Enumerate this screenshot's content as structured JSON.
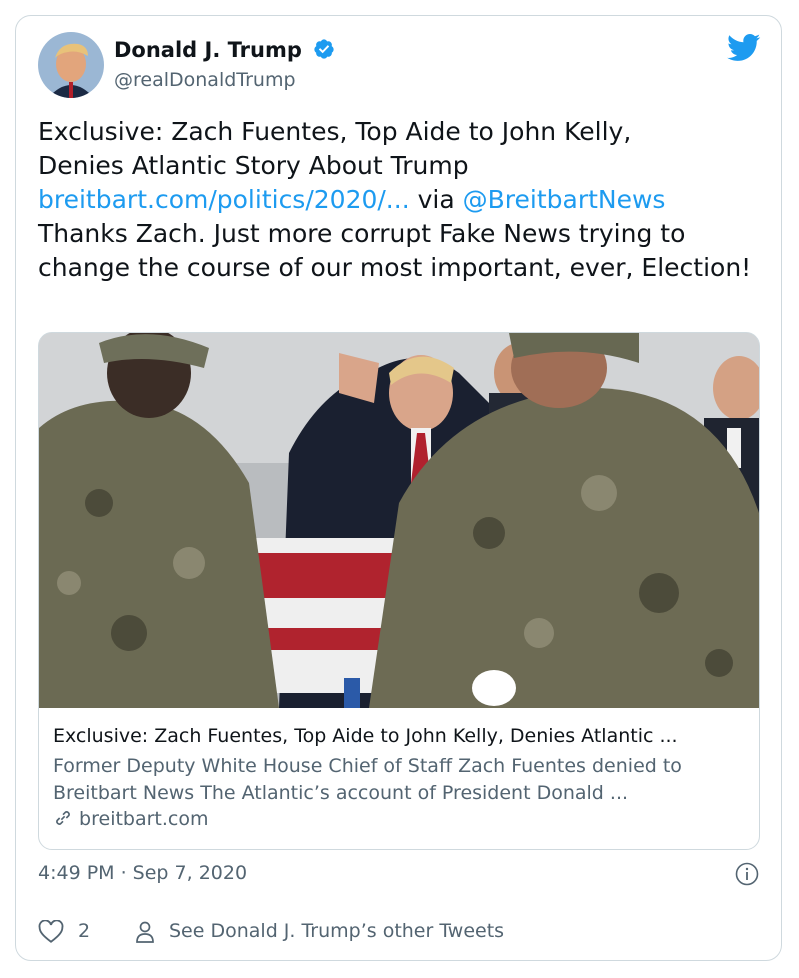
{
  "author": {
    "name": "Donald J. Trump",
    "handle": "@realDonaldTrump"
  },
  "tweet": {
    "line1": "Exclusive: Zach Fuentes, Top Aide to John Kelly,",
    "line2": "Denies Atlantic Story About Trump",
    "link_url": "breitbart.com/politics/2020/...",
    "via": " via ",
    "mention": "@BreitbartNews",
    "rest": "Thanks Zach. Just more corrupt Fake News trying to change the course of our most important, ever, Election!"
  },
  "link_card": {
    "title": "Exclusive: Zach Fuentes, Top Aide to John Kelly, Denies Atlantic ...",
    "description": "Former Deputy White House Chief of Staff Zach Fuentes denied to Breitbart News The Atlantic’s account of President Donald ...",
    "domain": "breitbart.com"
  },
  "meta": {
    "timestamp": "4:49 PM · Sep 7, 2020",
    "likes": "2",
    "other_tweets": "See Donald J. Trump’s other Tweets"
  },
  "icons": {
    "verified": "verified-badge-icon",
    "bird": "twitter-bird-icon",
    "like": "heart-icon",
    "person": "person-icon",
    "info": "info-icon",
    "link": "link-icon"
  },
  "colors": {
    "accent": "#1d9bf0",
    "text": "#0f1419",
    "secondary": "#536471",
    "border": "#cfd9de"
  }
}
